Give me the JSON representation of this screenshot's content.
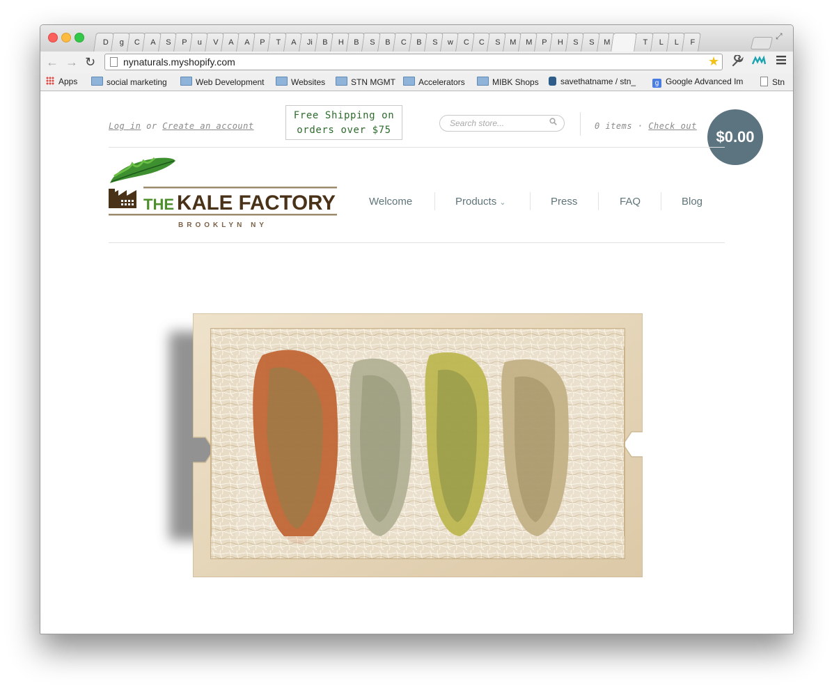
{
  "browser": {
    "tab_letters": [
      "D",
      "g",
      "C",
      "A",
      "S",
      "P",
      "u",
      "V",
      "A",
      "A",
      "P",
      "T",
      "A",
      "Ji",
      "B",
      "H",
      "B",
      "S",
      "B",
      "C",
      "B",
      "S",
      "w",
      "C",
      "C",
      "S",
      "M",
      "M",
      "P",
      "H",
      "S",
      "S",
      "M",
      "",
      "T",
      "L",
      "L",
      "F"
    ],
    "url": "nynaturals.myshopify.com",
    "bookmarks": [
      {
        "label": "Apps",
        "icon": "apps-grid-icon"
      },
      {
        "label": "social marketing",
        "icon": "folder-icon"
      },
      {
        "label": "Web Development",
        "icon": "folder-icon"
      },
      {
        "label": "Websites",
        "icon": "folder-icon"
      },
      {
        "label": "STN MGMT",
        "icon": "folder-icon"
      },
      {
        "label": "Accelerators",
        "icon": "folder-icon"
      },
      {
        "label": "MIBK Shops",
        "icon": "folder-icon"
      },
      {
        "label": "savethatname / stn_",
        "icon": "bucket-icon"
      },
      {
        "label": "Google Advanced Im",
        "icon": "google-icon"
      },
      {
        "label": "Stn",
        "icon": "document-icon"
      }
    ]
  },
  "header": {
    "login": "Log in",
    "or": "or",
    "create_account": "Create an account",
    "promo_line1": "Free Shipping on",
    "promo_line2": "orders over $75",
    "search_placeholder": "Search store...",
    "cart_items": "0 items",
    "dot": "·",
    "checkout": "Check out",
    "cart_total": "$0.00"
  },
  "logo": {
    "word_the": "THE",
    "word_rest": "KALE FACTORY",
    "tagline": "BROOKLYN NY"
  },
  "nav": {
    "items": [
      {
        "label": "Welcome"
      },
      {
        "label": "Products",
        "chevron": "⌄"
      },
      {
        "label": "Press"
      },
      {
        "label": "FAQ"
      },
      {
        "label": "Blog"
      }
    ]
  },
  "colors": {
    "accent_green": "#2d6b2c",
    "logo_brown": "#4a3218",
    "cart_bubble": "#5c7480",
    "nav_text": "#5f7579"
  }
}
